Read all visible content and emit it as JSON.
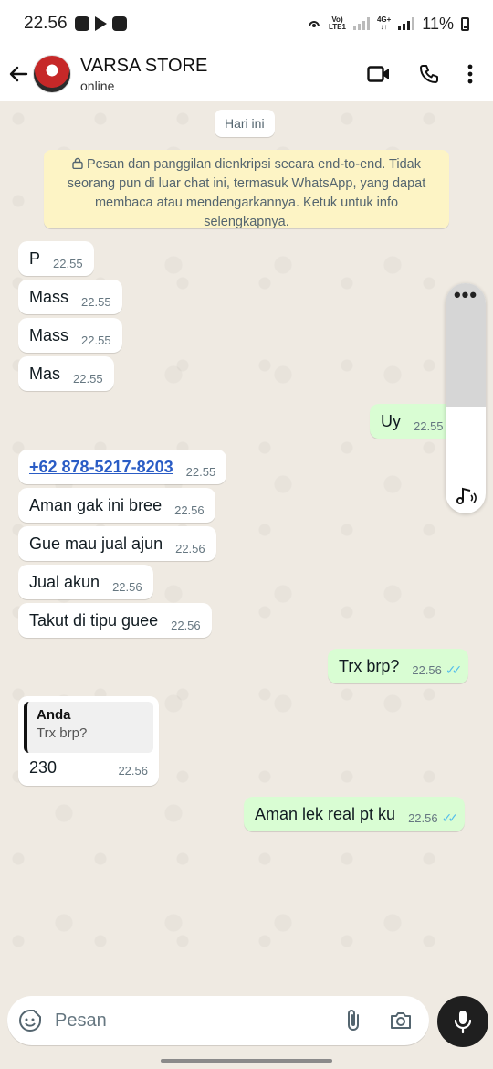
{
  "status_bar": {
    "time": "22.56",
    "network_top": "Vo)",
    "network_bottom": "LTE1",
    "network2_top": "4G+",
    "network2_bottom": "↓↑",
    "battery": "11%"
  },
  "header": {
    "contact_name": "VARSA STORE",
    "contact_status": "online"
  },
  "chat": {
    "date_chip": "Hari ini",
    "encryption_notice": "Pesan dan panggilan dienkripsi secara end-to-end. Tidak seorang pun di luar chat ini, termasuk WhatsApp, yang dapat membaca atau mendengarkannya. Ketuk untuk info selengkapnya.",
    "messages": [
      {
        "text": "P",
        "time": "22.55",
        "dir": "in"
      },
      {
        "text": "Mass",
        "time": "22.55",
        "dir": "in"
      },
      {
        "text": "Mass",
        "time": "22.55",
        "dir": "in"
      },
      {
        "text": "Mas",
        "time": "22.55",
        "dir": "in"
      },
      {
        "text": "Uy",
        "time": "22.55",
        "dir": "out"
      },
      {
        "text": "+62 878-5217-8203",
        "time": "22.55",
        "dir": "in"
      },
      {
        "text": "Aman gak ini bree",
        "time": "22.56",
        "dir": "in"
      },
      {
        "text": "Gue mau jual ajun",
        "time": "22.56",
        "dir": "in"
      },
      {
        "text": "Jual akun",
        "time": "22.56",
        "dir": "in"
      },
      {
        "text": "Takut di tipu guee",
        "time": "22.56",
        "dir": "in"
      },
      {
        "text": "Trx brp?",
        "time": "22.56",
        "dir": "out",
        "ticks": "✓✓"
      },
      {
        "text": "Aman lek real pt ku",
        "time": "22.56",
        "dir": "out",
        "ticks": "✓✓"
      }
    ],
    "reply": {
      "quote_name": "Anda",
      "quote_text": "Trx brp?",
      "text": "230",
      "time": "22.56"
    }
  },
  "input": {
    "placeholder": "Pesan"
  }
}
